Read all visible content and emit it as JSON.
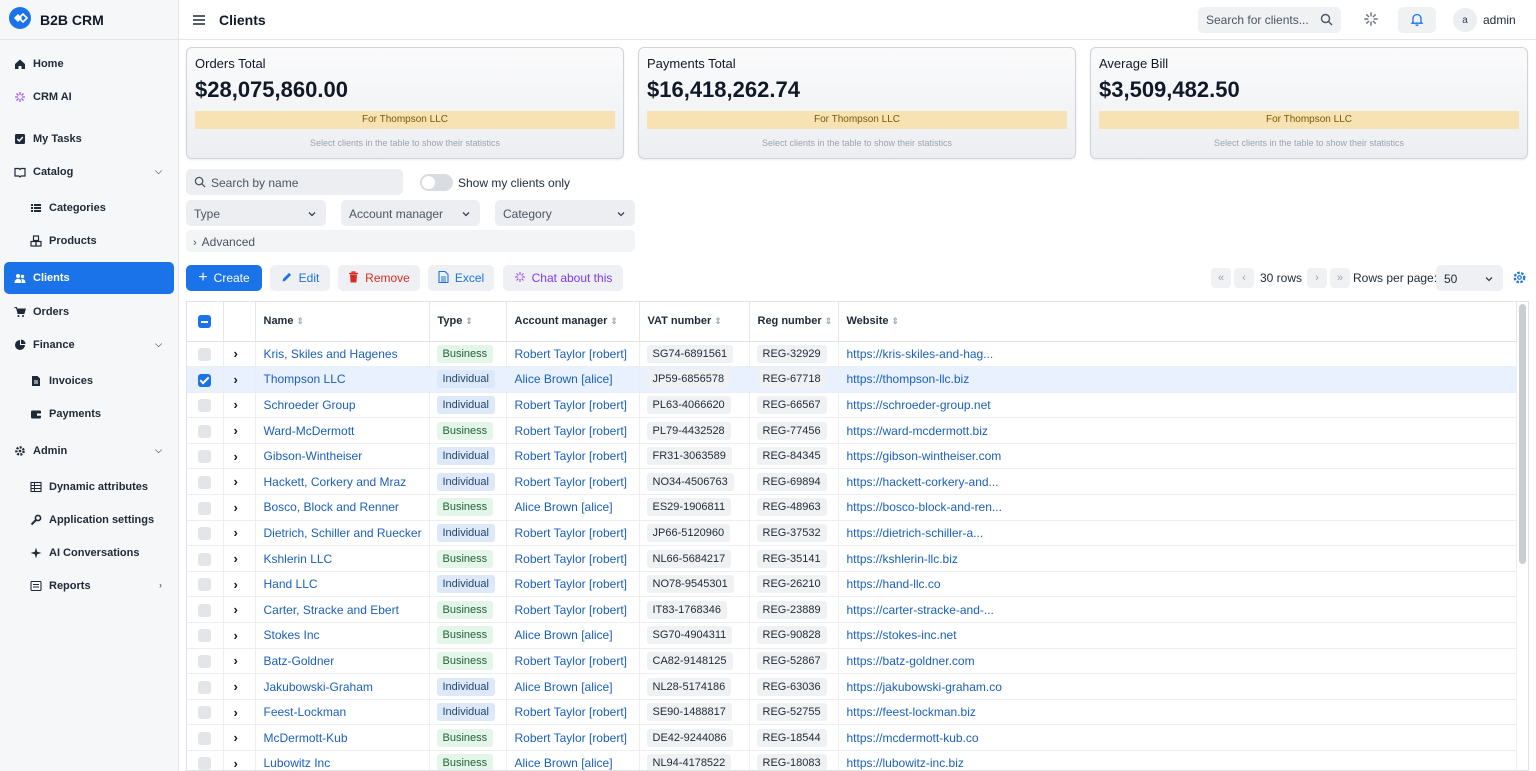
{
  "app": {
    "name": "B2B CRM"
  },
  "sidebar": {
    "items": [
      {
        "label": "Home",
        "icon": "home-icon"
      },
      {
        "label": "CRM AI",
        "icon": "sparkle-icon"
      },
      {
        "label": "My Tasks",
        "icon": "checkbox-icon"
      },
      {
        "label": "Catalog",
        "icon": "book-icon"
      },
      {
        "label": "Categories",
        "icon": "list-icon"
      },
      {
        "label": "Products",
        "icon": "cubes-icon"
      },
      {
        "label": "Clients",
        "icon": "users-icon"
      },
      {
        "label": "Orders",
        "icon": "cart-icon"
      },
      {
        "label": "Finance",
        "icon": "pie-icon"
      },
      {
        "label": "Invoices",
        "icon": "document-icon"
      },
      {
        "label": "Payments",
        "icon": "wallet-icon"
      },
      {
        "label": "Admin",
        "icon": "gear-icon"
      },
      {
        "label": "Dynamic attributes",
        "icon": "table-icon"
      },
      {
        "label": "Application settings",
        "icon": "wrench-icon"
      },
      {
        "label": "AI Conversations",
        "icon": "sparkle-icon"
      },
      {
        "label": "Reports",
        "icon": "report-icon"
      }
    ]
  },
  "header": {
    "title": "Clients",
    "search_placeholder": "Search for clients...",
    "user_initial": "a",
    "user_name": "admin"
  },
  "stats": [
    {
      "title": "Orders Total",
      "value": "$28,075,860.00",
      "for": "For Thompson LLC",
      "hint": "Select clients in the table to show their statistics"
    },
    {
      "title": "Payments Total",
      "value": "$16,418,262.74",
      "for": "For Thompson LLC",
      "hint": "Select clients in the table to show their statistics"
    },
    {
      "title": "Average Bill",
      "value": "$3,509,482.50",
      "for": "For Thompson LLC",
      "hint": "Select clients in the table to show their statistics"
    }
  ],
  "filters": {
    "name_placeholder": "Search by name",
    "my_clients_label": "Show my clients only",
    "type_label": "Type",
    "manager_label": "Account manager",
    "category_label": "Category",
    "advanced_label": "Advanced"
  },
  "toolbar": {
    "create": "Create",
    "edit": "Edit",
    "remove": "Remove",
    "excel": "Excel",
    "chat": "Chat about this",
    "rows": "30 rows",
    "rows_per_page_label": "Rows per page:",
    "rows_per_page": "50"
  },
  "table": {
    "columns": [
      "Name",
      "Type",
      "Account manager",
      "VAT number",
      "Reg number",
      "Website"
    ],
    "rows": [
      {
        "name": "Kris, Skiles and Hagenes",
        "type": "Business",
        "manager": "Robert Taylor [robert]",
        "vat": "SG74-6891561",
        "reg": "REG-32929",
        "website": "https://kris-skiles-and-hag...",
        "selected": false
      },
      {
        "name": "Thompson LLC",
        "type": "Individual",
        "manager": "Alice Brown [alice]",
        "vat": "JP59-6856578",
        "reg": "REG-67718",
        "website": "https://thompson-llc.biz",
        "selected": true
      },
      {
        "name": "Schroeder Group",
        "type": "Individual",
        "manager": "Robert Taylor [robert]",
        "vat": "PL63-4066620",
        "reg": "REG-66567",
        "website": "https://schroeder-group.net",
        "selected": false
      },
      {
        "name": "Ward-McDermott",
        "type": "Business",
        "manager": "Robert Taylor [robert]",
        "vat": "PL79-4432528",
        "reg": "REG-77456",
        "website": "https://ward-mcdermott.biz",
        "selected": false
      },
      {
        "name": "Gibson-Wintheiser",
        "type": "Individual",
        "manager": "Robert Taylor [robert]",
        "vat": "FR31-3063589",
        "reg": "REG-84345",
        "website": "https://gibson-wintheiser.com",
        "selected": false
      },
      {
        "name": "Hackett, Corkery and Mraz",
        "type": "Individual",
        "manager": "Robert Taylor [robert]",
        "vat": "NO34-4506763",
        "reg": "REG-69894",
        "website": "https://hackett-corkery-and...",
        "selected": false
      },
      {
        "name": "Bosco, Block and Renner",
        "type": "Business",
        "manager": "Alice Brown [alice]",
        "vat": "ES29-1906811",
        "reg": "REG-48963",
        "website": "https://bosco-block-and-ren...",
        "selected": false
      },
      {
        "name": "Dietrich, Schiller and Ruecker",
        "type": "Individual",
        "manager": "Robert Taylor [robert]",
        "vat": "JP66-5120960",
        "reg": "REG-37532",
        "website": "https://dietrich-schiller-a...",
        "selected": false
      },
      {
        "name": "Kshlerin LLC",
        "type": "Business",
        "manager": "Robert Taylor [robert]",
        "vat": "NL66-5684217",
        "reg": "REG-35141",
        "website": "https://kshlerin-llc.biz",
        "selected": false
      },
      {
        "name": "Hand LLC",
        "type": "Individual",
        "manager": "Robert Taylor [robert]",
        "vat": "NO78-9545301",
        "reg": "REG-26210",
        "website": "https://hand-llc.co",
        "selected": false
      },
      {
        "name": "Carter, Stracke and Ebert",
        "type": "Business",
        "manager": "Robert Taylor [robert]",
        "vat": "IT83-1768346",
        "reg": "REG-23889",
        "website": "https://carter-stracke-and-...",
        "selected": false
      },
      {
        "name": "Stokes Inc",
        "type": "Business",
        "manager": "Alice Brown [alice]",
        "vat": "SG70-4904311",
        "reg": "REG-90828",
        "website": "https://stokes-inc.net",
        "selected": false
      },
      {
        "name": "Batz-Goldner",
        "type": "Business",
        "manager": "Robert Taylor [robert]",
        "vat": "CA82-9148125",
        "reg": "REG-52867",
        "website": "https://batz-goldner.com",
        "selected": false
      },
      {
        "name": "Jakubowski-Graham",
        "type": "Individual",
        "manager": "Alice Brown [alice]",
        "vat": "NL28-5174186",
        "reg": "REG-63036",
        "website": "https://jakubowski-graham.co",
        "selected": false
      },
      {
        "name": "Feest-Lockman",
        "type": "Individual",
        "manager": "Robert Taylor [robert]",
        "vat": "SE90-1488817",
        "reg": "REG-52755",
        "website": "https://feest-lockman.biz",
        "selected": false
      },
      {
        "name": "McDermott-Kub",
        "type": "Business",
        "manager": "Robert Taylor [robert]",
        "vat": "DE42-9244086",
        "reg": "REG-18544",
        "website": "https://mcdermott-kub.co",
        "selected": false
      },
      {
        "name": "Lubowitz Inc",
        "type": "Business",
        "manager": "Alice Brown [alice]",
        "vat": "NL94-4178522",
        "reg": "REG-18083",
        "website": "https://lubowitz-inc.biz",
        "selected": false
      }
    ]
  },
  "colors": {
    "accent": "#1a73e8",
    "remove": "#d92d20",
    "ai": "#7c3aed",
    "highlight": "#f7e2b3"
  }
}
